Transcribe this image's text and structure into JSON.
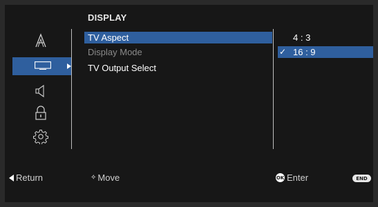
{
  "header": {
    "title": "DISPLAY"
  },
  "sidebar": {
    "icons": [
      {
        "name": "picture-icon",
        "glyph": "𝔸"
      },
      {
        "name": "display-icon",
        "selected": true
      },
      {
        "name": "speaker-icon"
      },
      {
        "name": "lock-icon"
      },
      {
        "name": "settings-gear-icon"
      }
    ]
  },
  "menu": {
    "items": [
      {
        "label": "TV Aspect",
        "state": "selected"
      },
      {
        "label": "Display Mode",
        "state": "disabled"
      },
      {
        "label": "TV Output Select",
        "state": "normal"
      }
    ]
  },
  "options": {
    "items": [
      {
        "label": "4 : 3",
        "checked": false
      },
      {
        "label": "16 : 9",
        "checked": true,
        "check_glyph": "✓"
      }
    ]
  },
  "footer": {
    "return_label": "Return",
    "move_label": "Move",
    "move_glyph": "✧",
    "enter_label": "Enter",
    "ok_badge": "OK",
    "end_badge": "END"
  },
  "colors": {
    "highlight": "#2f5f9e",
    "background": "#171717",
    "text_dim": "#8a8a8a"
  }
}
